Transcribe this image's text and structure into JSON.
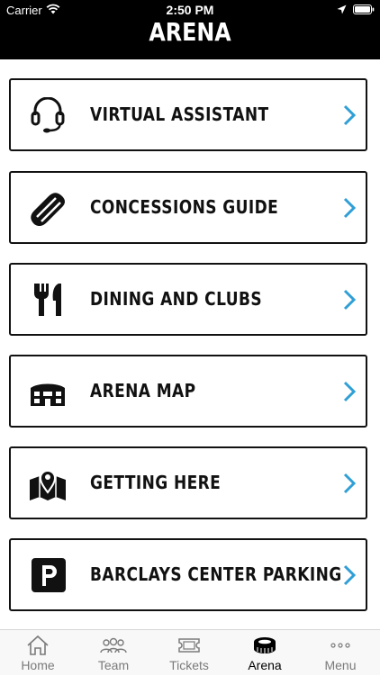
{
  "status_bar": {
    "carrier": "Carrier",
    "time": "2:50 PM"
  },
  "header": {
    "title": "ARENA"
  },
  "menu_items": [
    {
      "label": "VIRTUAL ASSISTANT",
      "icon": "headset-icon"
    },
    {
      "label": "CONCESSIONS GUIDE",
      "icon": "hotdog-icon"
    },
    {
      "label": "DINING AND CLUBS",
      "icon": "fork-knife-icon"
    },
    {
      "label": "ARENA MAP",
      "icon": "arena-building-icon"
    },
    {
      "label": "GETTING HERE",
      "icon": "map-pin-icon"
    },
    {
      "label": "BARCLAYS CENTER PARKING",
      "icon": "parking-icon"
    }
  ],
  "tabs": [
    {
      "label": "Home",
      "icon": "home-icon"
    },
    {
      "label": "Team",
      "icon": "team-icon"
    },
    {
      "label": "Tickets",
      "icon": "ticket-icon"
    },
    {
      "label": "Arena",
      "icon": "arena-icon",
      "active": true
    },
    {
      "label": "Menu",
      "icon": "more-icon"
    }
  ],
  "colors": {
    "header_bg": "#000000",
    "chevron": "#2f9fd6",
    "active_tab": "#000000",
    "inactive_tab": "#7a7a7a"
  }
}
